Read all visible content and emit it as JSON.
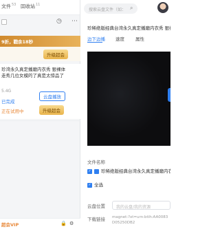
{
  "left": {
    "tabs": [
      {
        "label": "文件",
        "count": "53"
      },
      {
        "label": "回收站",
        "count": "11"
      }
    ],
    "promo": {
      "text": "9折，戳余18秒",
      "button": "升级超会"
    },
    "torrent": {
      "title": "珍湾永久真定播磨内衣秀 狠裸体走秀几位女模的了真是太惊品了",
      "size": "5.4G",
      "cloud_button": "云盘播放",
      "status_link": "已完成",
      "status_orange": "正在试用中",
      "upgrade_button": "升级超会"
    },
    "vip_label": "超会VIP"
  },
  "right": {
    "search_placeholder": "搜索云盘文件（如：",
    "title": "珍稀绝版经典台湾永久真定播磨内衣秀 狠裸体走",
    "tabs": [
      "边下边播",
      "速度",
      "属性"
    ],
    "file_name_label": "文件名称",
    "files": [
      {
        "name": "珍稀绝版经典台湾永久真定播磨内衣秀"
      },
      {
        "name": "全选"
      }
    ],
    "cloud_location_label": "云盘位置",
    "cloud_location_placeholder": "我的云盘/我的资源",
    "download_link_label": "下载链接",
    "magnet": "magnet:?xt=urn:btih:AA0083D05250DB2"
  }
}
